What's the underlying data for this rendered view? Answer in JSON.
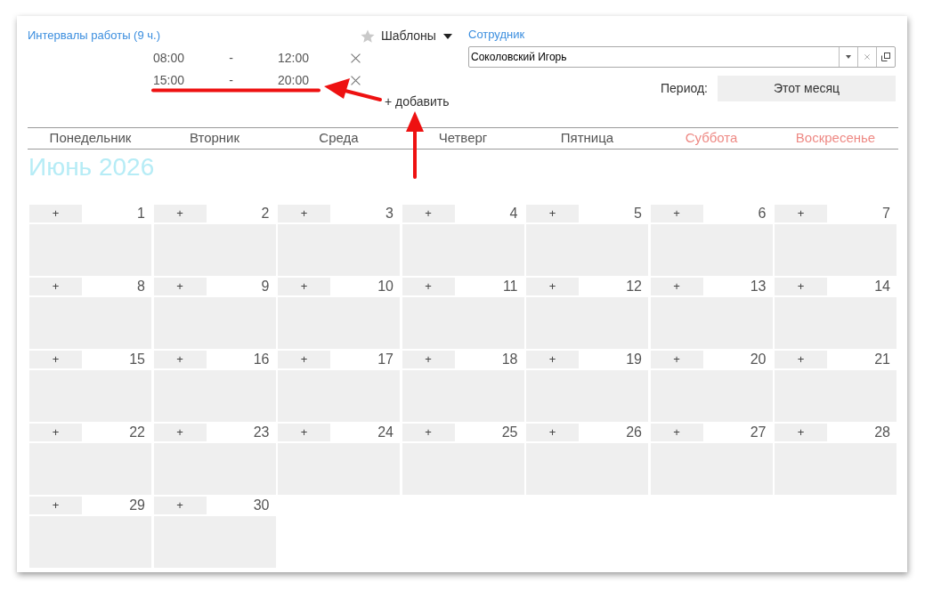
{
  "intervals": {
    "title": "Интервалы работы (9 ч.)",
    "rows": [
      {
        "start": "08:00",
        "separator": "-",
        "end": "12:00"
      },
      {
        "start": "15:00",
        "separator": "-",
        "end": "20:00"
      }
    ],
    "add_link": "+ добавить"
  },
  "templates": {
    "label": "Шаблоны"
  },
  "employee": {
    "label": "Сотрудник",
    "value": "Соколовский Игорь"
  },
  "period": {
    "label": "Период:",
    "value": "Этот месяц"
  },
  "calendar": {
    "weekdays": [
      {
        "label": "Понедельник",
        "weekend": false
      },
      {
        "label": "Вторник",
        "weekend": false
      },
      {
        "label": "Среда",
        "weekend": false
      },
      {
        "label": "Четверг",
        "weekend": false
      },
      {
        "label": "Пятница",
        "weekend": false
      },
      {
        "label": "Суббота",
        "weekend": true
      },
      {
        "label": "Воскресенье",
        "weekend": true
      }
    ],
    "month_title": "Июнь 2026",
    "weeks": [
      [
        {
          "number": "1",
          "add": "+"
        },
        {
          "number": "2",
          "add": "+"
        },
        {
          "number": "3",
          "add": "+"
        },
        {
          "number": "4",
          "add": "+"
        },
        {
          "number": "5",
          "add": "+"
        },
        {
          "number": "6",
          "add": "+"
        },
        {
          "number": "7",
          "add": "+"
        }
      ],
      [
        {
          "number": "8",
          "add": "+"
        },
        {
          "number": "9",
          "add": "+"
        },
        {
          "number": "10",
          "add": "+"
        },
        {
          "number": "11",
          "add": "+"
        },
        {
          "number": "12",
          "add": "+"
        },
        {
          "number": "13",
          "add": "+"
        },
        {
          "number": "14",
          "add": "+"
        }
      ],
      [
        {
          "number": "15",
          "add": "+"
        },
        {
          "number": "16",
          "add": "+"
        },
        {
          "number": "17",
          "add": "+"
        },
        {
          "number": "18",
          "add": "+"
        },
        {
          "number": "19",
          "add": "+"
        },
        {
          "number": "20",
          "add": "+"
        },
        {
          "number": "21",
          "add": "+"
        }
      ],
      [
        {
          "number": "22",
          "add": "+"
        },
        {
          "number": "23",
          "add": "+"
        },
        {
          "number": "24",
          "add": "+"
        },
        {
          "number": "25",
          "add": "+"
        },
        {
          "number": "26",
          "add": "+"
        },
        {
          "number": "27",
          "add": "+"
        },
        {
          "number": "28",
          "add": "+"
        }
      ],
      [
        {
          "number": "29",
          "add": "+"
        },
        {
          "number": "30",
          "add": "+"
        }
      ]
    ]
  }
}
